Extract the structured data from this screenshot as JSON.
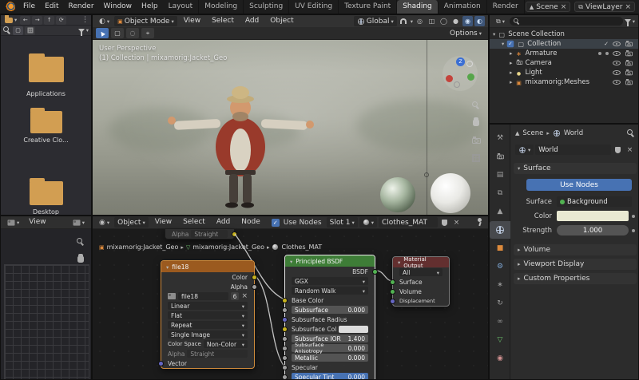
{
  "icons": {
    "blender-logo": "orange-blender-mark",
    "caret-down": "▾",
    "caret-right": "▸",
    "check": "✓",
    "close": "×",
    "menu-dots": "⋮",
    "back-arrow": "←",
    "forward-arrow": "→",
    "up-arrow": "↑",
    "refresh-arrow": "⟳",
    "search-icon": "css-magnifier",
    "filter-icon": "css-funnel",
    "eye-icon": "css-eye",
    "camera-icon": "css-camera",
    "hand-icon": "css-hand",
    "grid-icon": "css-grid",
    "pin-icon": "css-pin",
    "shield-icon": "css-shield",
    "globe-icon": "css-globe",
    "magnet-icon": "css-magnet",
    "cursor-tool-icon": "css-cursor",
    "material-sphere-icon": "css-sphere"
  },
  "colors": {
    "accent": "#4772b3",
    "image_node_header": "#9b5a1f",
    "bsdf_node_header": "#3e7d37",
    "output_node_header": "#632f2f",
    "folder": "#d29e52",
    "active_node_outline": "#e8e8e8"
  },
  "topbar": {
    "menus": [
      "File",
      "Edit",
      "Render",
      "Window",
      "Help"
    ],
    "workspaces": [
      "Layout",
      "Modeling",
      "Sculpting",
      "UV Editing",
      "Texture Paint",
      "Shading",
      "Animation",
      "Render"
    ],
    "active_workspace": "Shading",
    "scene": "Scene",
    "viewlayer": "ViewLayer"
  },
  "file_browser": {
    "folders": [
      "Applications",
      "Creative Clo...",
      "Desktop"
    ]
  },
  "viewport": {
    "mode": "Object Mode",
    "menus": [
      "View",
      "Select",
      "Add",
      "Object"
    ],
    "orientation": "Global",
    "options": "Options",
    "overlay": {
      "line1": "User Perspective",
      "line2": "(1) Collection | mixamorig:Jacket_Geo"
    },
    "axis_z": "Z"
  },
  "outliner": {
    "root": "Scene Collection",
    "collection": "Collection",
    "items": [
      "Armature",
      "Camera",
      "Light",
      "mixamorig:Meshes"
    ]
  },
  "properties": {
    "tabs": [
      "tool",
      "render",
      "output",
      "view-layer",
      "scene",
      "world",
      "object",
      "modifiers",
      "particles",
      "physics",
      "constraints",
      "object-data",
      "material"
    ],
    "active_tab": "world",
    "breadcrumb": {
      "scene": "Scene",
      "world": "World"
    },
    "datablock": "World",
    "surface": {
      "title": "Surface",
      "use_nodes": "Use Nodes",
      "surface_label": "Surface",
      "surface_value": "Background",
      "color_label": "Color",
      "strength_label": "Strength",
      "strength_value": "1.000"
    },
    "collapsed": [
      "Volume",
      "Viewport Display",
      "Custom Properties"
    ]
  },
  "shader": {
    "type": "Object",
    "menus": [
      "View",
      "Select",
      "Add",
      "Node"
    ],
    "use_nodes": "Use Nodes",
    "slot": "Slot 1",
    "material": "Clothes_MAT",
    "breadcrumb": [
      "mixamorig:Jacket_Geo",
      "mixamorig:Jacket_Geo",
      "Clothes_MAT"
    ],
    "clipped": {
      "label": "Alpha",
      "value": "Straight"
    },
    "image_node": {
      "title": "file18",
      "out_color": "Color",
      "out_alpha": "Alpha",
      "image_name": "file18",
      "users": "6",
      "interpolation": "Linear",
      "projection": "Flat",
      "extension": "Repeat",
      "source": "Single Image",
      "color_space_label": "Color Space",
      "color_space": "Non-Color",
      "alpha_label": "Alpha",
      "alpha_mode": "Straight",
      "vector": "Vector"
    },
    "bsdf_node": {
      "title": "Principled BSDF",
      "out": "BSDF",
      "distribution": "GGX",
      "method": "Random Walk",
      "rows": [
        {
          "label": "Base Color",
          "value": ""
        },
        {
          "label": "Subsurface",
          "value": "0.000"
        },
        {
          "label": "Subsurface Radius",
          "value": ""
        },
        {
          "label": "Subsurface Col",
          "value": ""
        },
        {
          "label": "Subsurface IOR",
          "value": "1.400"
        },
        {
          "label": "Subsurface Anisotropy",
          "value": "0.000"
        },
        {
          "label": "Metallic",
          "value": "0.000"
        },
        {
          "label": "Specular",
          "value": ""
        },
        {
          "label": "Specular Tint",
          "value": "0.000"
        }
      ]
    },
    "output_node": {
      "title": "Material Output",
      "target": "All",
      "inputs": [
        "Surface",
        "Volume",
        "Displacement"
      ]
    }
  },
  "image_editor": {
    "menus": [
      "View"
    ]
  }
}
